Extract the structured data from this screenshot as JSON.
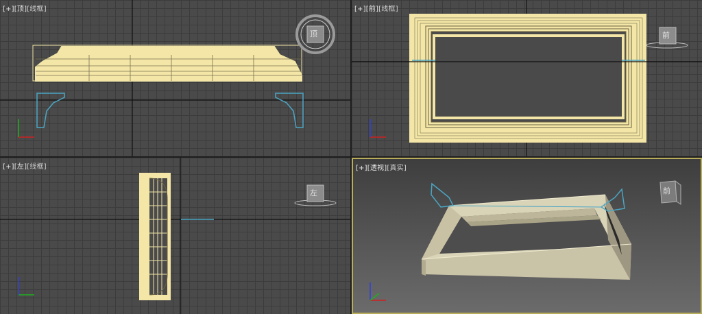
{
  "viewports": [
    {
      "plus": "[+]",
      "name": "[顶]",
      "mode": "[线框]"
    },
    {
      "plus": "[+]",
      "name": "[前]",
      "mode": "[线框]"
    },
    {
      "plus": "[+]",
      "name": "[左]",
      "mode": "[线框]"
    },
    {
      "plus": "[+]",
      "name": "[透视]",
      "mode": "[真实]"
    }
  ],
  "viewcube": {
    "top": "顶",
    "front": "前",
    "left": "左",
    "persp": "前"
  },
  "colors": {
    "object": "#f3e6a6",
    "selection_cyan": "#4aa6c4",
    "active_border": "#b8ad5a",
    "axis_x": "#d02020",
    "axis_y": "#20b020",
    "axis_z": "#3040e0"
  }
}
